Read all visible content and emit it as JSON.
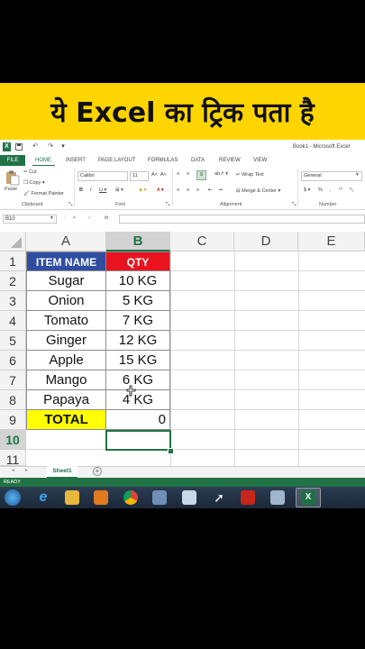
{
  "banner": {
    "text": "ये Excel का ट्रिक पता है"
  },
  "window": {
    "title": "Book1 - Microsoft Excel"
  },
  "ribbon_tabs": {
    "file": "FILE",
    "tabs": [
      "HOME",
      "INSERT",
      "PAGE LAYOUT",
      "FORMULAS",
      "DATA",
      "REVIEW",
      "VIEW"
    ]
  },
  "ribbon": {
    "cut": "Cut",
    "copy": "Copy",
    "format_painter": "Format Painter",
    "paste": "Paste",
    "font_name": "Calibri",
    "font_size": "11",
    "wrap_text": "Wrap Text",
    "merge_center": "Merge & Center",
    "number_format": "General",
    "groups": {
      "clipboard": "Clipboard",
      "font": "Font",
      "alignment": "Alignment",
      "number": "Number"
    }
  },
  "formula_bar": {
    "name_box": "B10",
    "fx": "fx"
  },
  "columns": [
    "A",
    "B",
    "C",
    "D",
    "E"
  ],
  "rows": [
    "1",
    "2",
    "3",
    "4",
    "5",
    "6",
    "7",
    "8",
    "9",
    "10",
    "11"
  ],
  "table": {
    "header": {
      "item": "ITEM NAME",
      "qty": "QTY"
    },
    "items": [
      {
        "name": "Sugar",
        "qty": "10 KG"
      },
      {
        "name": "Onion",
        "qty": "5 KG"
      },
      {
        "name": "Tomato",
        "qty": "7 KG"
      },
      {
        "name": "Ginger",
        "qty": "12 KG"
      },
      {
        "name": "Apple",
        "qty": "15 KG"
      },
      {
        "name": "Mango",
        "qty": "6 KG"
      },
      {
        "name": "Papaya",
        "qty": "4 KG"
      }
    ],
    "total_label": "TOTAL",
    "total_value": "0"
  },
  "sheet_tabs": {
    "active": "Sheet1",
    "add": "+"
  },
  "status": {
    "text": "READY"
  },
  "colors": {
    "excel_green": "#217346",
    "banner_yellow": "#ffd500",
    "header_blue": "#2f4ea1",
    "header_red": "#e8131f",
    "total_yellow": "#ffff00"
  },
  "taskbar_icons": [
    "start-orb-icon",
    "internet-explorer-icon",
    "file-explorer-icon",
    "media-player-icon",
    "chrome-icon",
    "network-icon",
    "folder-icon",
    "cursor-tool-icon",
    "pdf-icon",
    "screen-capture-icon",
    "excel-icon"
  ]
}
